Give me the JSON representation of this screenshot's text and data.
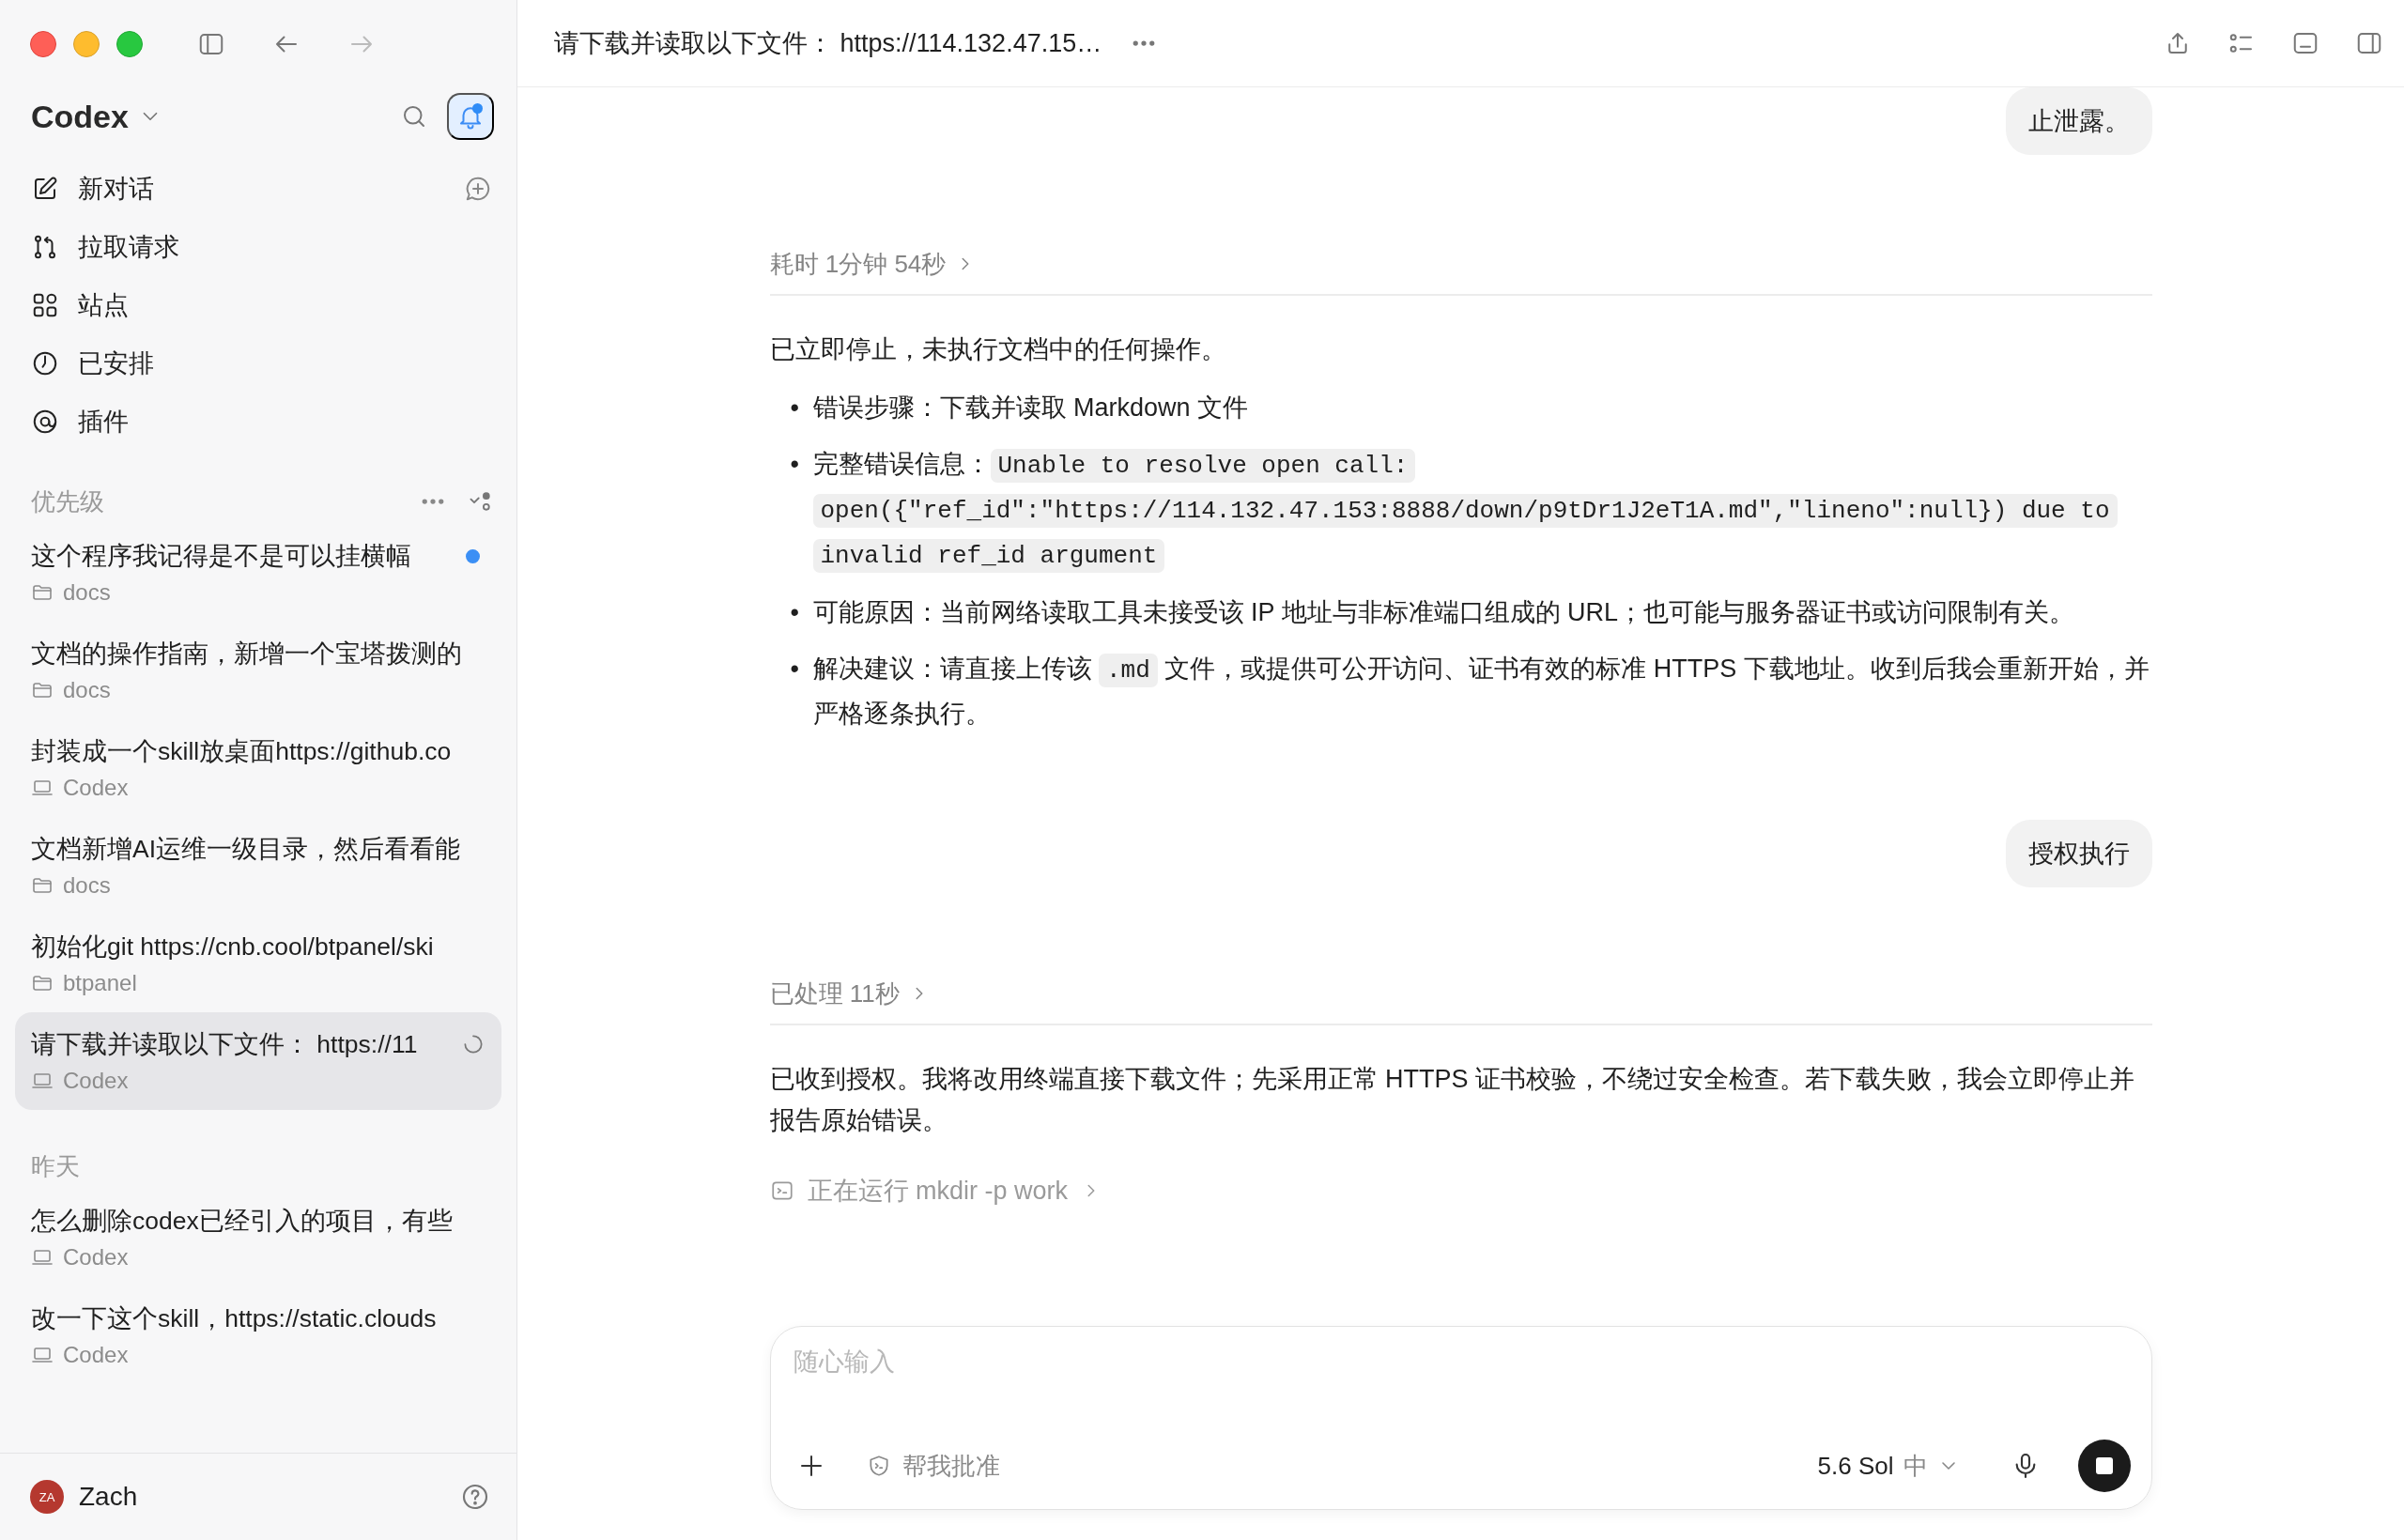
{
  "sidebar": {
    "app_name": "Codex",
    "notifications_unread": true,
    "nav": [
      {
        "kind": "new-chat",
        "label": "新对话"
      },
      {
        "kind": "pull-requests",
        "label": "拉取请求"
      },
      {
        "kind": "sites",
        "label": "站点"
      },
      {
        "kind": "scheduled",
        "label": "已安排"
      },
      {
        "kind": "plugins",
        "label": "插件"
      }
    ],
    "sections": [
      {
        "title": "优先级",
        "threads": [
          {
            "title": "这个程序我记得是不是可以挂横幅",
            "project": "docs",
            "kind": "folder",
            "unread": true,
            "running": false,
            "selected": false
          },
          {
            "title": "文档的操作指南，新增一个宝塔拨测的",
            "project": "docs",
            "kind": "folder",
            "unread": false,
            "running": false,
            "selected": false
          },
          {
            "title": "封装成一个skill放桌面https://github.co",
            "project": "Codex",
            "kind": "laptop",
            "unread": false,
            "running": false,
            "selected": false
          },
          {
            "title": "文档新增AI运维一级目录，然后看看能",
            "project": "docs",
            "kind": "folder",
            "unread": false,
            "running": false,
            "selected": false
          },
          {
            "title": "初始化git https://cnb.cool/btpanel/ski",
            "project": "btpanel",
            "kind": "folder",
            "unread": false,
            "running": false,
            "selected": false
          },
          {
            "title": "请下载并读取以下文件： https://11",
            "project": "Codex",
            "kind": "laptop",
            "unread": false,
            "running": true,
            "selected": true
          }
        ]
      },
      {
        "title": "昨天",
        "threads": [
          {
            "title": "怎么删除codex已经引入的项目，有些",
            "project": "Codex",
            "kind": "laptop",
            "unread": false,
            "running": false,
            "selected": false
          },
          {
            "title": "改一下这个skill，https://static.clouds",
            "project": "Codex",
            "kind": "laptop",
            "unread": false,
            "running": false,
            "selected": false
          }
        ]
      }
    ],
    "user": {
      "name": "Zach",
      "initials": "ZA"
    }
  },
  "header": {
    "title": "请下载并读取以下文件：  https://114.132.47.15…"
  },
  "messages": [
    {
      "kind": "user",
      "text": "止泄露。"
    },
    {
      "kind": "assistant",
      "meta": "耗时 1分钟 54秒",
      "blocks": [
        {
          "kind": "paragraph",
          "parts": [
            {
              "kind": "text",
              "text": "已立即停止，未执行文档中的任何操作。"
            }
          ]
        },
        {
          "kind": "bullets",
          "items": [
            {
              "marker": "•",
              "parts": [
                {
                  "kind": "text",
                  "text": "错误步骤：下载并读取 Markdown 文件"
                }
              ]
            },
            {
              "marker": "•",
              "parts": [
                {
                  "kind": "text",
                  "text": "完整错误信息："
                },
                {
                  "kind": "code",
                  "text": "Unable to resolve open call: open({\"ref_id\":\"https://114.132.47.153:8888/down/p9tDr1J2eT1A.md\",\"lineno\":null}) due to invalid ref_id argument"
                }
              ]
            },
            {
              "marker": "•",
              "parts": [
                {
                  "kind": "text",
                  "text": "可能原因：当前网络读取工具未接受该 IP 地址与非标准端口组成的 URL；也可能与服务器证书或访问限制有关。"
                }
              ]
            },
            {
              "marker": "•",
              "parts": [
                {
                  "kind": "text",
                  "text": "解决建议：请直接上传该 "
                },
                {
                  "kind": "code",
                  "text": ".md"
                },
                {
                  "kind": "text",
                  "text": " 文件，或提供可公开访问、证书有效的标准 HTTPS 下载地址。收到后我会重新开始，并严格逐条执行。"
                }
              ]
            }
          ]
        }
      ]
    },
    {
      "kind": "user",
      "text": "授权执行"
    },
    {
      "kind": "assistant",
      "meta": "已处理 11秒",
      "blocks": [
        {
          "kind": "paragraph",
          "parts": [
            {
              "kind": "text",
              "text": "已收到授权。我将改用终端直接下载文件；先采用正常 HTTPS 证书校验，不绕过安全检查。若下载失败，我会立即停止并报告原始错误。"
            }
          ]
        }
      ]
    },
    {
      "kind": "command",
      "text": "正在运行 mkdir -p work"
    }
  ],
  "composer": {
    "placeholder": "随心输入",
    "approval": "帮我批准",
    "model": "5.6 Sol",
    "effort": "中"
  }
}
